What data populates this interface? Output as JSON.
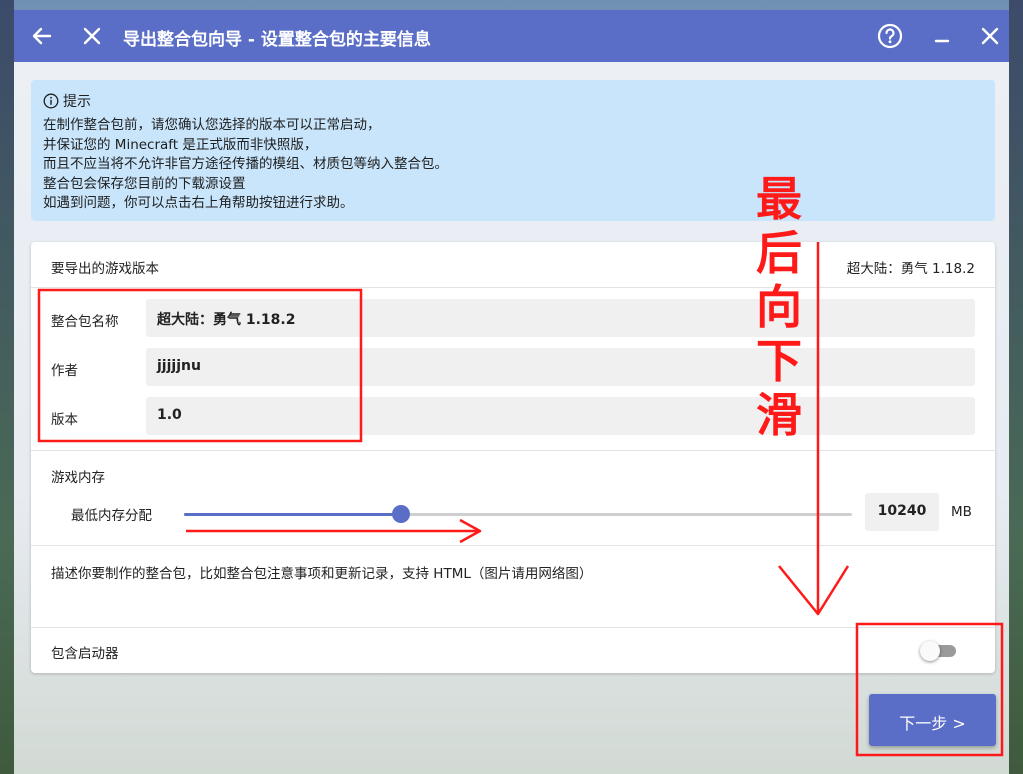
{
  "window": {
    "title": "导出整合包向导 - 设置整合包的主要信息"
  },
  "hint": {
    "heading": "提示",
    "lines": [
      "在制作整合包前，请您确认您选择的版本可以正常启动，",
      "并保证您的 Minecraft 是正式版而非快照版，",
      "而且不应当将不允许非官方途径传播的模组、材质包等纳入整合包。",
      "整合包会保存您目前的下载源设置",
      "如遇到问题，你可以点击右上角帮助按钮进行求助。"
    ]
  },
  "form": {
    "game_version_label": "要导出的游戏版本",
    "game_version_value": "超大陆：勇气 1.18.2",
    "name_label": "整合包名称",
    "name_value": "超大陆：勇气 1.18.2",
    "author_label": "作者",
    "author_value": "jjjjjnu",
    "version_label": "版本",
    "version_value": "1.0",
    "memory_section_label": "游戏内存",
    "min_memory_label": "最低内存分配",
    "min_memory_value": "10240",
    "memory_unit": "MB",
    "memory_slider_fraction": 0.325,
    "description_placeholder": "描述你要制作的整合包，比如整合包注意事项和更新记录，支持 HTML（图片请用网络图）",
    "include_launcher_label": "包含启动器",
    "include_launcher_on": false
  },
  "next_button_label": "下一步 >",
  "annotation": {
    "text_chars": [
      "最",
      "后",
      "向",
      "下",
      "滑"
    ]
  },
  "colors": {
    "accent": "#5b6ec7",
    "hint_bg": "#c8e5fb",
    "annotation": "#ff1a1a"
  }
}
